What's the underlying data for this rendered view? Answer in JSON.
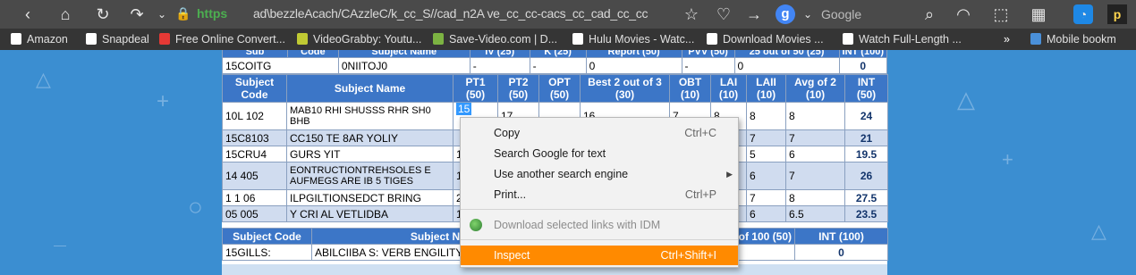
{
  "browser": {
    "url_protocol": "https",
    "url_rest": "ad\\bezzleAcach/CAzzleC/k_cc_S//cad_n2A ve_cc_cc-cacs_cc_cad_cc_cc",
    "search_engine_letter": "g",
    "search_placeholder": "Google"
  },
  "bookmarks": [
    {
      "label": "Amazon",
      "color": "#ffffff"
    },
    {
      "label": "Snapdeal",
      "color": "#ffffff"
    },
    {
      "label": "Free Online Convert...",
      "color": "#e53935"
    },
    {
      "label": "VideoGrabby: Youtu...",
      "color": "#c0ca33"
    },
    {
      "label": "Save-Video.com | D...",
      "color": "#7cb342"
    },
    {
      "label": "Hulu Movies - Watc...",
      "color": "#ffffff"
    },
    {
      "label": "Download Movies ...",
      "color": "#ffffff"
    },
    {
      "label": "Watch Full-Length ...",
      "color": "#ffffff"
    },
    {
      "label": "Mobile bookm",
      "color": "#4a90d9"
    }
  ],
  "table_top": {
    "partial_headers": [
      "Sub",
      "Code",
      "Subject Name",
      "IV (25)",
      "K (25)",
      "Report (50)",
      "PVV (50)",
      "25 out of 50 (25)",
      "INT (100)"
    ],
    "row": [
      "15COITG",
      "0NIITOJ0",
      "-",
      "-",
      "0",
      "-",
      "0",
      "0"
    ]
  },
  "table": {
    "headers": [
      "Subject Code",
      "Subject Name",
      "PT1 (50)",
      "PT2 (50)",
      "OPT (50)",
      "Best 2 out of 3 (30)",
      "OBT (10)",
      "LAI (10)",
      "LAII (10)",
      "Avg of 2 (10)",
      "INT (50)"
    ],
    "rows": [
      {
        "code": "10L 102",
        "name": "MAB10 RHI SHUSSS RHR SH0 BHB",
        "pt1": "15",
        "pt2": "17",
        "opt": "",
        "best": "16",
        "obt": "7",
        "lai": "8",
        "laii": "8",
        "avg": "8",
        "int": "24"
      },
      {
        "code": "15C8103",
        "name": "CC150 TE 8AR YOLIY",
        "pt1": "",
        "pt2": "",
        "opt": "",
        "best": "",
        "obt": "",
        "lai": "",
        "laii": "7",
        "avg": "7",
        "int": "21"
      },
      {
        "code": "15CRU4",
        "name": "GURS YIT",
        "pt1": "1",
        "pt2": "",
        "opt": "",
        "best": "",
        "obt": "",
        "lai": "",
        "laii": "5",
        "avg": "6",
        "int": "19.5"
      },
      {
        "code": "14 405",
        "name": "EONTRUCTIONTREHSOLES E AUFMEGS ARE IB 5 TIGES",
        "pt1": "1",
        "pt2": "",
        "opt": "",
        "best": "",
        "obt": "",
        "lai": "",
        "laii": "6",
        "avg": "7",
        "int": "26"
      },
      {
        "code": "1 1 06",
        "name": "ILPGILTIONSEDCT BRING",
        "pt1": "2",
        "pt2": "",
        "opt": "",
        "best": "",
        "obt": "",
        "lai": "",
        "laii": "7",
        "avg": "8",
        "int": "27.5"
      },
      {
        "code": "05 005",
        "name": "Y CRI AL VETLIDBA",
        "pt1": "1",
        "pt2": "",
        "opt": "",
        "best": "",
        "obt": "",
        "lai": "",
        "laii": "6",
        "avg": "6.5",
        "int": "23.5"
      }
    ]
  },
  "table_bottom": {
    "headers": [
      "Subject Code",
      "Subject Name",
      "out of 100 (50)",
      "INT (100)"
    ],
    "row": [
      "15GILLS:",
      "ABILCIIBA S: VERB ENGILITY",
      "",
      "0"
    ]
  },
  "context_menu": {
    "items": [
      {
        "label": "Copy",
        "shortcut": "Ctrl+C"
      },
      {
        "label": "Search Google for text",
        "shortcut": ""
      },
      {
        "label": "Use another search engine",
        "shortcut": ""
      },
      {
        "label": "Print...",
        "shortcut": "Ctrl+P"
      },
      {
        "label": "Download selected links with IDM",
        "shortcut": ""
      },
      {
        "label": "Inspect",
        "shortcut": "Ctrl+Shift+I"
      }
    ]
  }
}
